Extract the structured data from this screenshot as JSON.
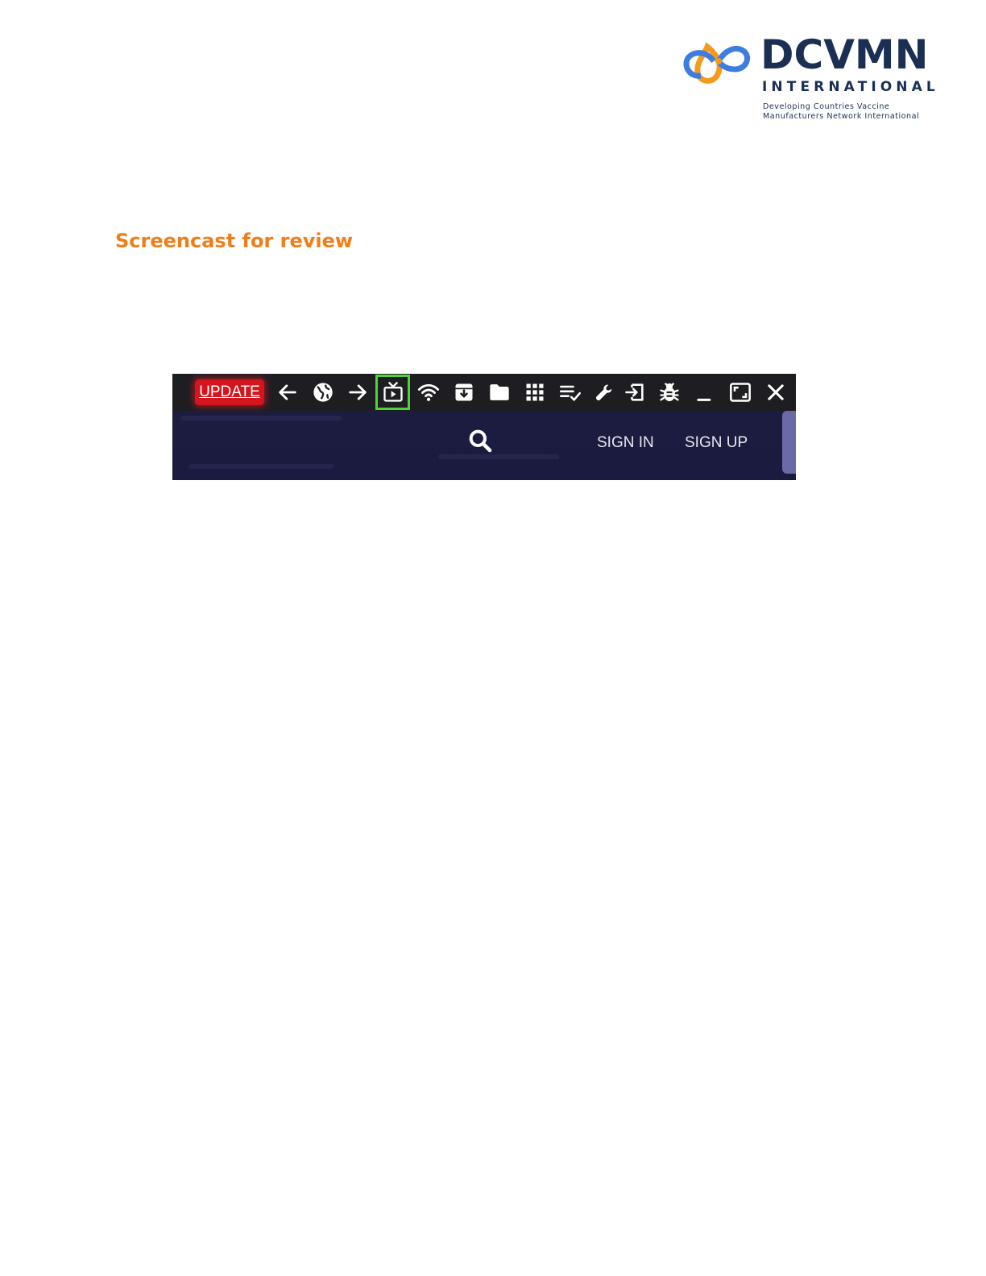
{
  "logo": {
    "name": "DCVMN",
    "subtitle": "INTERNATIONAL",
    "tagline_line1": "Developing Countries Vaccine",
    "tagline_line2": "Manufacturers Network International",
    "colors": {
      "navy": "#1b2f55",
      "orange": "#f49a1e",
      "blue": "#3d7de0"
    }
  },
  "heading": "Screencast for review",
  "screenshot": {
    "toolbar": {
      "update_label": "UPDATE",
      "icons": [
        "back-arrow-icon",
        "globe-icon",
        "forward-arrow-icon",
        "tv-play-icon",
        "wifi-icon",
        "archive-icon",
        "folder-icon",
        "grid-icon",
        "checklist-icon",
        "wrench-icon",
        "sign-in-icon",
        "bug-icon",
        "minimize-icon",
        "maximize-icon",
        "close-icon"
      ],
      "highlighted_icon": "tv-play-icon",
      "highlight_color": "#4fd23a",
      "update_color": "#d4151e"
    },
    "nav": {
      "search_icon": "search-icon",
      "sign_in": "SIGN IN",
      "sign_up": "SIGN UP"
    }
  }
}
